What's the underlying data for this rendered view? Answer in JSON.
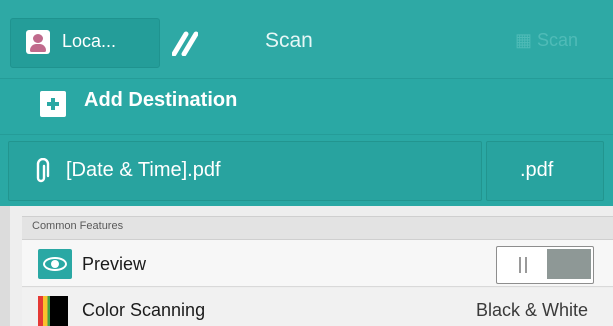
{
  "header": {
    "tab_local_label": "Loca...",
    "app_title": "Scan",
    "ghost_label": "Scan"
  },
  "destination": {
    "add_label": "Add Destination"
  },
  "file": {
    "name": "[Date & Time].pdf",
    "extension": ".pdf"
  },
  "features": {
    "section_label": "Common Features",
    "preview": {
      "label": "Preview",
      "toggle_state": "off"
    },
    "color_scanning": {
      "label": "Color Scanning",
      "value": "Black & White"
    }
  },
  "colors": {
    "teal": "#2aa8a4",
    "panel_bg": "#eeeeee"
  },
  "icons": {
    "user": "user-icon",
    "wand": "magic-wand-icon",
    "add": "plus-icon",
    "attachment": "paperclip-icon",
    "preview": "eye-icon",
    "color": "color-palette-icon"
  }
}
